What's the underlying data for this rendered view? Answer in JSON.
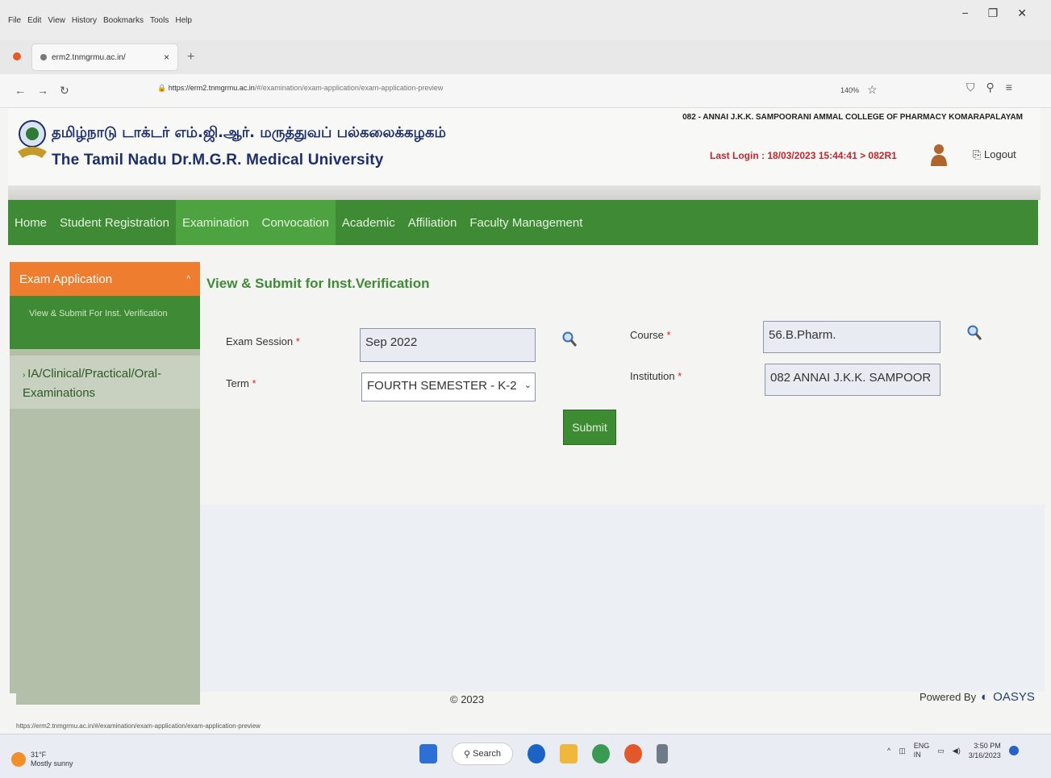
{
  "browser": {
    "menu": [
      "File",
      "Edit",
      "View",
      "History",
      "Bookmarks",
      "Tools",
      "Help"
    ],
    "window_controls": [
      "−",
      "❐",
      "✕"
    ],
    "tab_title": "erm2.tnmgrmu.ac.in/",
    "url_domain": "https://erm2.tnmgrmu.ac.in",
    "url_path": "/#/examination/exam-application/exam-application-preview",
    "zoom": "140%"
  },
  "header": {
    "tamil_name": "தமிழ்நாடு டாக்டர் எம்.ஜி.ஆர். மருத்துவப் பல்கலைக்கழகம்",
    "english_name": "The Tamil Nadu Dr.M.G.R. Medical University",
    "college": "082 - ANNAI J.K.K. SAMPOORANI AMMAL COLLEGE OF PHARMACY KOMARAPALAYAM",
    "last_login": "Last Login : 18/03/2023 15:44:41 > 082R1",
    "logout": "Logout"
  },
  "nav": {
    "items": [
      "Home",
      "Student Registration",
      "Examination",
      "Convocation",
      "Academic",
      "Affiliation",
      "Faculty Management"
    ]
  },
  "sidebar": {
    "section": "Exam Application",
    "sub_item": "View & Submit For Inst. Verification",
    "item2": "IA/Clinical/Practical/Oral-Examinations"
  },
  "form": {
    "title": "View & Submit for Inst.Verification",
    "exam_session_label": "Exam Session",
    "exam_session_value": "Sep 2022",
    "term_label": "Term",
    "term_value": "FOURTH SEMESTER - K-2",
    "course_label": "Course",
    "course_value": "56.B.Pharm.",
    "institution_label": "Institution",
    "institution_value": "082 ANNAI J.K.K. SAMPOOR",
    "required_mark": "*",
    "submit": "Submit"
  },
  "footer": {
    "copyright": "© 2023",
    "powered_by": "Powered By",
    "vendor": "OASYS",
    "status_url": "https://erm2.tnmgrmu.ac.in/#/examination/exam-application/exam-application-preview"
  },
  "taskbar": {
    "temperature": "31°F",
    "weather": "Mostly sunny",
    "search": "Search",
    "lang": "ENG",
    "region": "IN",
    "time": "3:50 PM",
    "date": "3/16/2023"
  }
}
